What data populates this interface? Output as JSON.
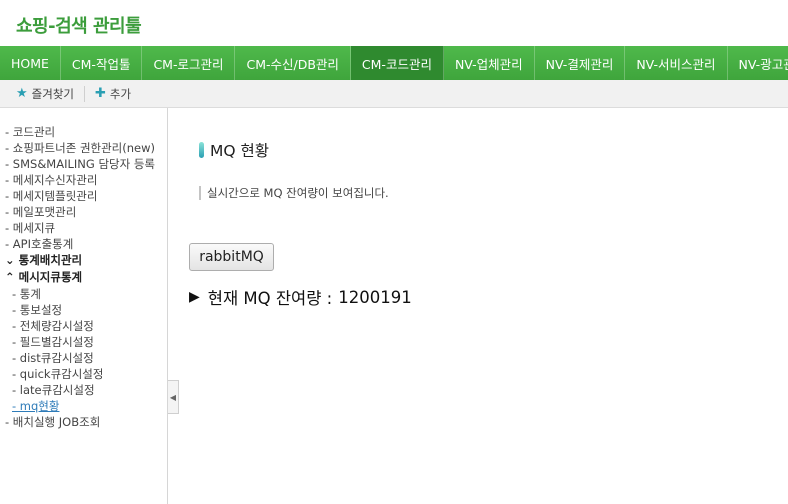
{
  "app": {
    "title": "쇼핑-검색 관리툴"
  },
  "nav": {
    "items": [
      {
        "label": "HOME",
        "active": false
      },
      {
        "label": "CM-작업툴",
        "active": false
      },
      {
        "label": "CM-로그관리",
        "active": false
      },
      {
        "label": "CM-수신/DB관리",
        "active": false
      },
      {
        "label": "CM-코드관리",
        "active": true
      },
      {
        "label": "NV-업체관리",
        "active": false
      },
      {
        "label": "NV-결제관리",
        "active": false
      },
      {
        "label": "NV-서비스관리",
        "active": false
      },
      {
        "label": "NV-광고관리",
        "active": false
      }
    ]
  },
  "favorites": {
    "bookmarks_label": "즐겨찾기",
    "add_label": "추가"
  },
  "sidebar": {
    "items": [
      {
        "label": "- 코드관리",
        "kind": "item"
      },
      {
        "label": "- 쇼핑파트너존 권한관리(new)",
        "kind": "item"
      },
      {
        "label": "- SMS&MAILING 담당자 등록",
        "kind": "item"
      },
      {
        "label": "- 메세지수신자관리",
        "kind": "item"
      },
      {
        "label": "- 메세지템플릿관리",
        "kind": "item"
      },
      {
        "label": "- 메일포맷관리",
        "kind": "item"
      },
      {
        "label": "- 메세지큐",
        "kind": "item"
      },
      {
        "label": "- API호출통계",
        "kind": "item"
      },
      {
        "label": "⌄ 통계배치관리",
        "kind": "group"
      },
      {
        "label": "⌃ 메시지큐통계",
        "kind": "group"
      },
      {
        "label": "- 통계",
        "kind": "sub"
      },
      {
        "label": "- 통보설정",
        "kind": "sub"
      },
      {
        "label": "- 전체량감시설정",
        "kind": "sub"
      },
      {
        "label": "- 필드별감시설정",
        "kind": "sub"
      },
      {
        "label": "- dist큐감시설정",
        "kind": "sub"
      },
      {
        "label": "- quick큐감시설정",
        "kind": "sub"
      },
      {
        "label": "- late큐감시설정",
        "kind": "sub"
      },
      {
        "label": "- mq현황",
        "kind": "sub",
        "current": true
      },
      {
        "label": "- 배치실행 JOB조회",
        "kind": "item"
      }
    ]
  },
  "main": {
    "title": "MQ 현황",
    "description": "실시간으로 MQ 잔여량이 보여집니다.",
    "button_label": "rabbitMQ",
    "status_arrow": "▶",
    "status_label": "현재 MQ 잔여량 :",
    "status_count": "1200191"
  },
  "colors": {
    "brand_green": "#3fa53c",
    "active_tab": "#2f8a2f",
    "accent_teal": "#2a9fb3",
    "link_blue": "#2e7bb8"
  }
}
